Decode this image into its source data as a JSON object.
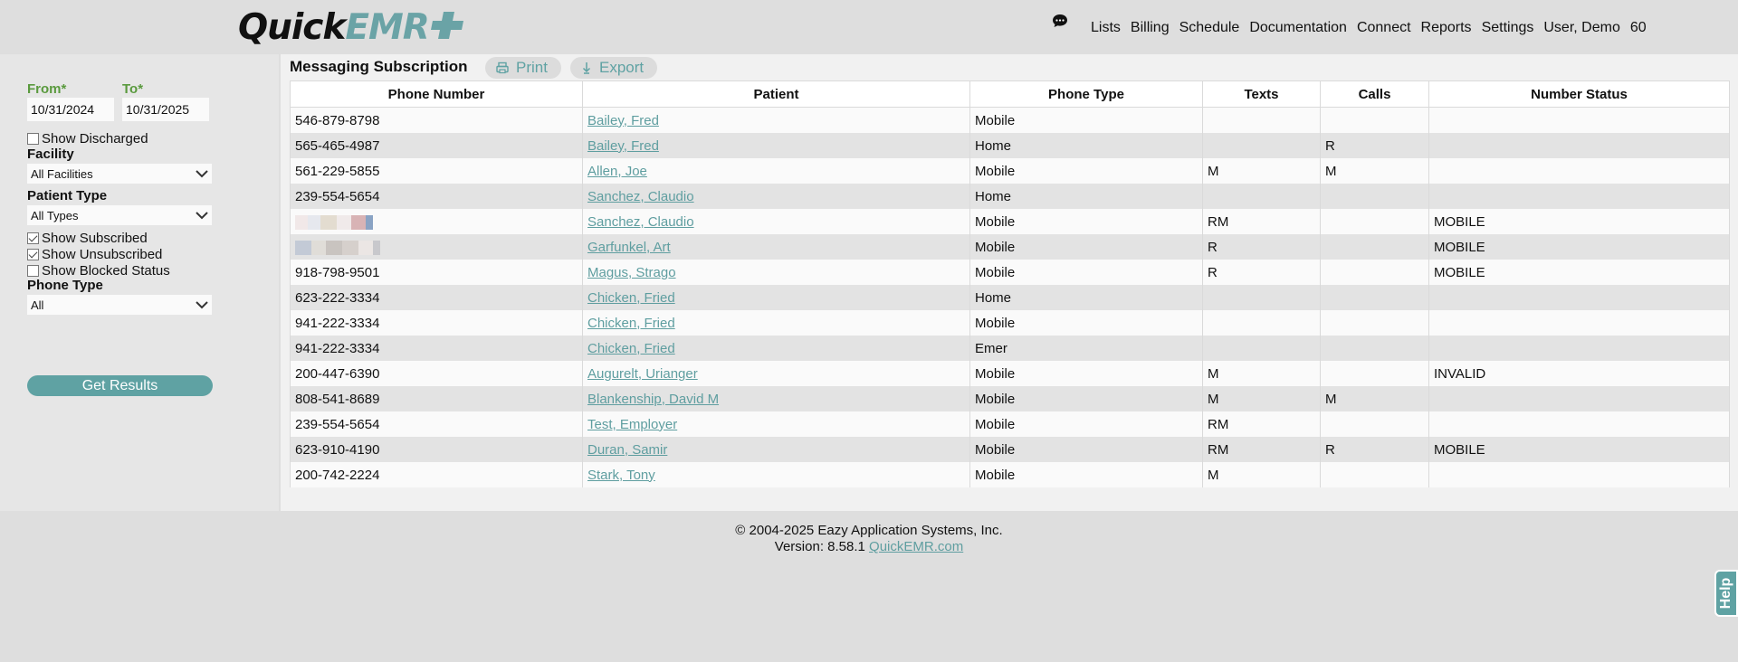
{
  "header": {
    "logo_quick": "Quick",
    "logo_emr": "EMR",
    "nav": [
      "Lists",
      "Billing",
      "Schedule",
      "Documentation",
      "Connect",
      "Reports",
      "Settings",
      "User, Demo",
      "60"
    ]
  },
  "sidebar": {
    "from_label": "From*",
    "to_label": "To*",
    "from_value": "10/31/2024",
    "to_value": "10/31/2025",
    "show_discharged": "Show Discharged",
    "facility_label": "Facility",
    "facility_value": "All Facilities",
    "patient_type_label": "Patient Type",
    "patient_type_value": "All Types",
    "show_subscribed": "Show Subscribed",
    "show_unsubscribed": "Show Unsubscribed",
    "show_blocked": "Show Blocked Status",
    "phone_type_label": "Phone Type",
    "phone_type_value": "All",
    "get_results": "Get Results"
  },
  "main": {
    "title": "Messaging Subscription",
    "print": "Print",
    "export": "Export",
    "columns": [
      "Phone Number",
      "Patient",
      "Phone Type",
      "Texts",
      "Calls",
      "Number Status"
    ],
    "rows": [
      [
        "546-879-8798",
        "Bailey, Fred",
        "Mobile",
        "",
        "",
        ""
      ],
      [
        "565-465-4987",
        "Bailey, Fred",
        "Home",
        "",
        "R",
        ""
      ],
      [
        "561-229-5855",
        "Allen, Joe",
        "Mobile",
        "M",
        "M",
        ""
      ],
      [
        "239-554-5654",
        "Sanchez, Claudio",
        "Home",
        "",
        "",
        ""
      ],
      [
        "",
        "Sanchez, Claudio",
        "Mobile",
        "RM",
        "",
        "MOBILE"
      ],
      [
        "",
        "Garfunkel, Art",
        "Mobile",
        "R",
        "",
        "MOBILE"
      ],
      [
        "918-798-9501",
        "Magus, Strago",
        "Mobile",
        "R",
        "",
        "MOBILE"
      ],
      [
        "623-222-3334",
        "Chicken, Fried",
        "Home",
        "",
        "",
        ""
      ],
      [
        "941-222-3334",
        "Chicken, Fried",
        "Mobile",
        "",
        "",
        ""
      ],
      [
        "941-222-3334",
        "Chicken, Fried",
        "Emer",
        "",
        "",
        ""
      ],
      [
        "200-447-6390",
        "Augurelt, Urianger",
        "Mobile",
        "M",
        "",
        "INVALID"
      ],
      [
        "808-541-8689",
        "Blankenship, David M",
        "Mobile",
        "M",
        "M",
        ""
      ],
      [
        "239-554-5654",
        "Test, Employer",
        "Mobile",
        "RM",
        "",
        ""
      ],
      [
        "623-910-4190",
        "Duran, Samir",
        "Mobile",
        "RM",
        "R",
        "MOBILE"
      ],
      [
        "200-742-2224",
        "Stark, Tony",
        "Mobile",
        "M",
        "",
        ""
      ]
    ]
  },
  "footer": {
    "copyright": "© 2004-2025 Eazy Application Systems, Inc.",
    "version": "Version: 8.58.1",
    "link": "QuickEMR.com"
  },
  "help": "Help"
}
